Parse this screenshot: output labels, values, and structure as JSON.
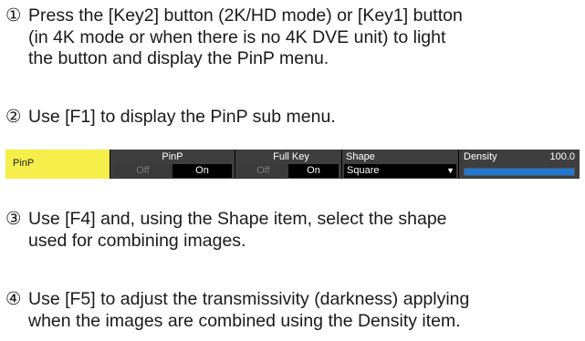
{
  "steps": [
    {
      "num": "①",
      "text": "Press the [Key2] button (2K/HD mode) or [Key1] button\n(in 4K mode or when there is no 4K DVE unit) to light\nthe button and display the PinP menu."
    },
    {
      "num": "②",
      "text": "Use [F1] to display the PinP sub menu."
    },
    {
      "num": "③",
      "text": "Use [F4] and, using the Shape item, select the shape\nused for combining images."
    },
    {
      "num": "④",
      "text": "Use [F5] to adjust the transmissivity (darkness) applying\nwhen the images are combined using the Density item."
    }
  ],
  "menu": {
    "name": "PinP",
    "pinp": {
      "label": "PinP",
      "off": "Off",
      "on": "On"
    },
    "fullkey": {
      "label": "Full Key",
      "off": "Off",
      "on": "On"
    },
    "shape": {
      "label": "Shape",
      "value": "Square",
      "arrow": "▼"
    },
    "density": {
      "label": "Density",
      "value": "100.0",
      "fill_percent": 100
    }
  },
  "colors": {
    "menu_name_bg": "#f6ee4a",
    "slider_fill": "#1f7ad6",
    "cell_bg": "#3e3e3e"
  }
}
